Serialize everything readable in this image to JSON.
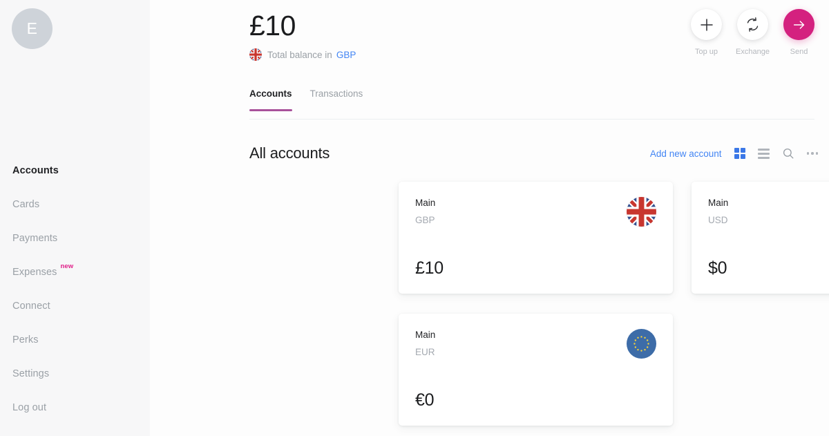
{
  "sidebar": {
    "avatar_initial": "E",
    "items": [
      {
        "label": "Accounts",
        "active": true,
        "badge": ""
      },
      {
        "label": "Cards",
        "active": false,
        "badge": ""
      },
      {
        "label": "Payments",
        "active": false,
        "badge": ""
      },
      {
        "label": "Expenses",
        "active": false,
        "badge": "new"
      },
      {
        "label": "Connect",
        "active": false,
        "badge": ""
      },
      {
        "label": "Perks",
        "active": false,
        "badge": ""
      },
      {
        "label": "Settings",
        "active": false,
        "badge": ""
      },
      {
        "label": "Log out",
        "active": false,
        "badge": ""
      }
    ]
  },
  "header": {
    "total_balance": "£10",
    "balance_caption": "Total balance in",
    "balance_currency": "GBP",
    "balance_flag_icon": "uk-flag-icon",
    "actions": [
      {
        "label": "Top up",
        "icon": "plus-icon",
        "style": "light"
      },
      {
        "label": "Exchange",
        "icon": "exchange-icon",
        "style": "light"
      },
      {
        "label": "Send",
        "icon": "arrow-right-icon",
        "style": "accent"
      }
    ]
  },
  "tabs": [
    {
      "label": "Accounts",
      "active": true
    },
    {
      "label": "Transactions",
      "active": false
    }
  ],
  "section": {
    "title": "All accounts",
    "add_link": "Add new account",
    "tools": [
      {
        "icon": "grid-view-icon",
        "active": true
      },
      {
        "icon": "list-view-icon",
        "active": false
      },
      {
        "icon": "search-icon",
        "active": false
      },
      {
        "icon": "more-options-icon",
        "active": false
      }
    ]
  },
  "accounts": [
    {
      "name": "Main",
      "currency": "GBP",
      "balance": "£10",
      "flag_icon": "uk-flag-icon"
    },
    {
      "name": "Main",
      "currency": "USD",
      "balance": "$0",
      "flag_icon": "us-flag-icon"
    },
    {
      "name": "Main",
      "currency": "EUR",
      "balance": "€0",
      "flag_icon": "eu-flag-icon"
    }
  ],
  "colors": {
    "accent_pink": "#d4217f",
    "tab_underline": "#a8519a",
    "link_blue": "#4285f4",
    "grid_active_blue": "#3b78e7",
    "badge_pink": "#e0218a",
    "sidebar_bg": "#f7f7f8"
  }
}
